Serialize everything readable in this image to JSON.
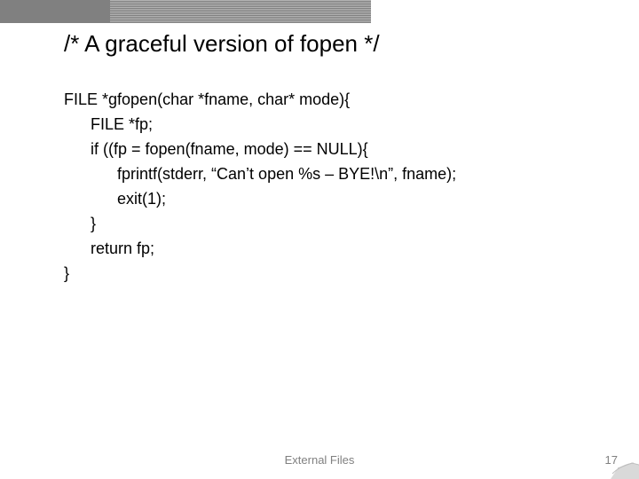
{
  "title": "/* A graceful version of fopen */",
  "code": {
    "l1": "FILE *gfopen(char *fname, char* mode){",
    "l2": "      FILE *fp;",
    "l3": "      if ((fp = fopen(fname, mode) == NULL){",
    "l4": "            fprintf(stderr, “Can’t open %s – BYE!\\n”, fname);",
    "l5": "            exit(1);",
    "l6": "      }",
    "l7": "      return fp;",
    "l8": "}"
  },
  "footer": {
    "center": "External Files",
    "page": "17"
  }
}
